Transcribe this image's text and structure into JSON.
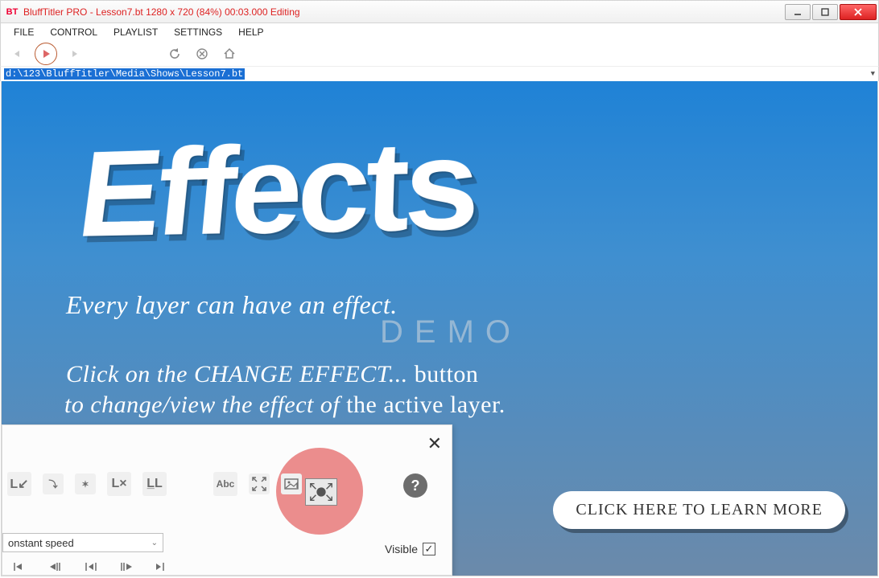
{
  "titlebar": {
    "app_icon": "BT",
    "title": " BluffTitler PRO  - Lesson7.bt 1280 x 720 (84%) 00:03.000 Editing"
  },
  "menu": {
    "file": "FILE",
    "control": "CONTROL",
    "playlist": "PLAYLIST",
    "settings": "SETTINGS",
    "help": "HELP"
  },
  "path": "d:\\123\\BluffTitler\\Media\\Shows\\Lesson7.bt",
  "viewport": {
    "title": "Effects",
    "line1": "Every layer can have an effect.",
    "demo": "DEMO",
    "line2_a": "Click on the CHANGE EFFECT... ",
    "line2_b": "button",
    "line3_a": "to change/view the effect of ",
    "line3_b": "the active layer.",
    "learn_more": "CLICK HERE TO LEARN MORE"
  },
  "panel": {
    "dropdown_value": "onstant speed",
    "visible_label": "Visible",
    "icons": {
      "l_arrow": "L↙",
      "attach": "⤵",
      "star": "✶",
      "lx": "L×",
      "ll": "L̲L",
      "abc": "Abc",
      "expand": "⤢",
      "image": "▣",
      "change": "⇲"
    }
  }
}
